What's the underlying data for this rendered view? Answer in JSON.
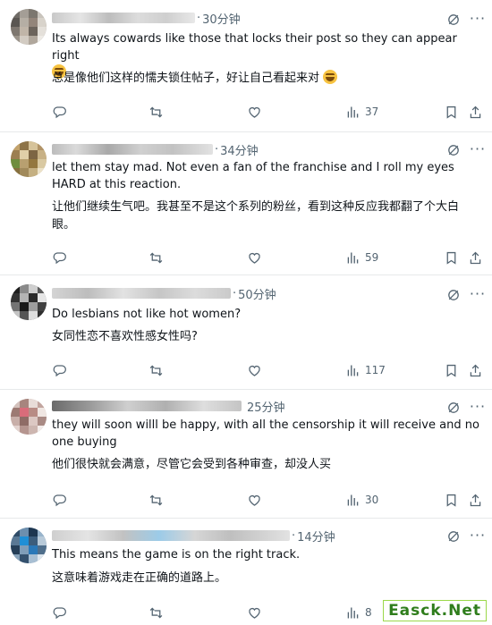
{
  "posts": [
    {
      "time": "30分钟",
      "text_en": "Its always cowards like those that locks their post so they can appear right",
      "text_zh": "总是像他们这样的懦夫锁住帖子，好让自己看起来对",
      "views": "37",
      "emoji": "grinning-squinting-face"
    },
    {
      "time": "34分钟",
      "text_en": "let them stay mad. Not even a fan of the franchise and I roll my eyes HARD at this reaction.",
      "text_zh": "让他们继续生气吧。我甚至不是这个系列的粉丝，看到这种反应我都翻了个大白眼。",
      "views": "59"
    },
    {
      "time": "50分钟",
      "text_en": "Do lesbians not like hot women?",
      "text_zh": "女同性恋不喜欢性感女性吗?",
      "views": "117"
    },
    {
      "time": "25分钟",
      "text_en": "they will soon willl be happy, with all the censorship it will receive and no one buying",
      "text_zh": "他们很快就会满意，尽管它会受到各种审查，却没人买",
      "views": "30"
    },
    {
      "time": "14分钟",
      "text_en": "This means the game is on the right track.",
      "text_zh": "这意味着游戏走在正确的道路上。",
      "views": "8"
    }
  ],
  "icons": {
    "reply": "reply-icon",
    "repost": "repost-icon",
    "like": "heart-icon",
    "views": "views-icon",
    "bookmark": "bookmark-icon",
    "share": "share-icon",
    "grok": "grok-icon",
    "more": "more-icon"
  },
  "watermark": "Easck.Net"
}
